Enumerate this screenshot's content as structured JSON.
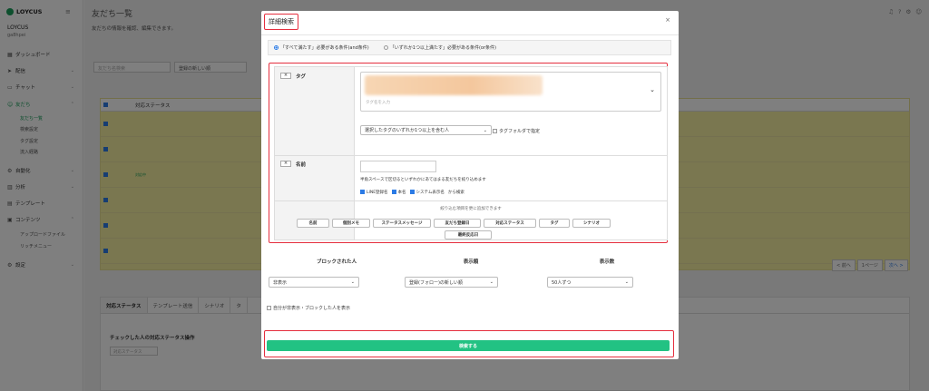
{
  "sidebar": {
    "logo": "LOYCUS",
    "account_name": "LOYCUS",
    "account_id": "ga8hpei",
    "items": [
      {
        "label": "ダッシュボード",
        "icon": "grid-icon"
      },
      {
        "label": "配信",
        "icon": "send-icon"
      },
      {
        "label": "チャット",
        "icon": "chat-icon"
      },
      {
        "label": "友だち",
        "icon": "users-icon"
      },
      {
        "label": "自動化",
        "icon": "automation-icon"
      },
      {
        "label": "分析",
        "icon": "chart-icon"
      },
      {
        "label": "テンプレート",
        "icon": "template-icon"
      },
      {
        "label": "コンテンツ",
        "icon": "content-icon"
      },
      {
        "label": "設定",
        "icon": "gear-icon"
      }
    ],
    "friend_sub": [
      "友だち一覧",
      "検索設定",
      "タグ設定",
      "流入経路"
    ],
    "content_sub": [
      "アップロードファイル",
      "リッチメニュー"
    ]
  },
  "page": {
    "title": "友だち一覧",
    "description": "友だちの情報を確認、編集できます。",
    "search_placeholder": "友だち名検索",
    "sort_value": "登録の新しい順",
    "col_status": "対応ステータス",
    "status_badge": "対応中",
    "pager": {
      "prev": "< 前へ",
      "page": "1ページ",
      "next": "次へ >"
    },
    "bottom_tabs": [
      "対応ステータス",
      "テンプレート送信",
      "シナリオ",
      "タ"
    ],
    "bottom_label": "チェックした人の対応ステータス操作",
    "bottom_select": "対応ステータス"
  },
  "modal": {
    "title": "詳細検索",
    "close": "×",
    "radio_all": "「すべて満たす」必要がある条件(and条件)",
    "radio_any": "「いずれか1つ以上満たす」必要がある条件(or条件)",
    "remove": "×",
    "tag_label": "タグ",
    "tag_placeholder": "タグ名を入力",
    "tag_condition": "選択したタグのいずれか1つ以上を含む人",
    "tag_folder": "タグフォルダで指定",
    "name_label": "名前",
    "name_hint": "半角スペースで区切るといずれかにあてはまる友だちを絞り込めます",
    "name_checks": [
      "LINE登録名",
      "本名",
      "システム表示名"
    ],
    "name_checks_suffix": "から検索",
    "add_hint": "絞り込む項目を更に追加できます",
    "add_buttons": [
      "名前",
      "個別メモ",
      "ステータスメッセージ",
      "友だち登録日",
      "対応ステータス",
      "タグ",
      "シナリオ",
      "最終反応日"
    ],
    "blocked_label": "ブロックされた人",
    "blocked_value": "非表示",
    "order_label": "表示順",
    "order_value": "登録(フォロー)の新しい順",
    "count_label": "表示数",
    "count_value": "50人ずつ",
    "self_hidden": "自分が非表示・ブロックした人を表示",
    "search_button": "検索する"
  },
  "colors": {
    "accent": "#1a9e5b",
    "search_button": "#22c283",
    "highlight": "#e52e3e",
    "row_bg": "#f4eea1"
  }
}
